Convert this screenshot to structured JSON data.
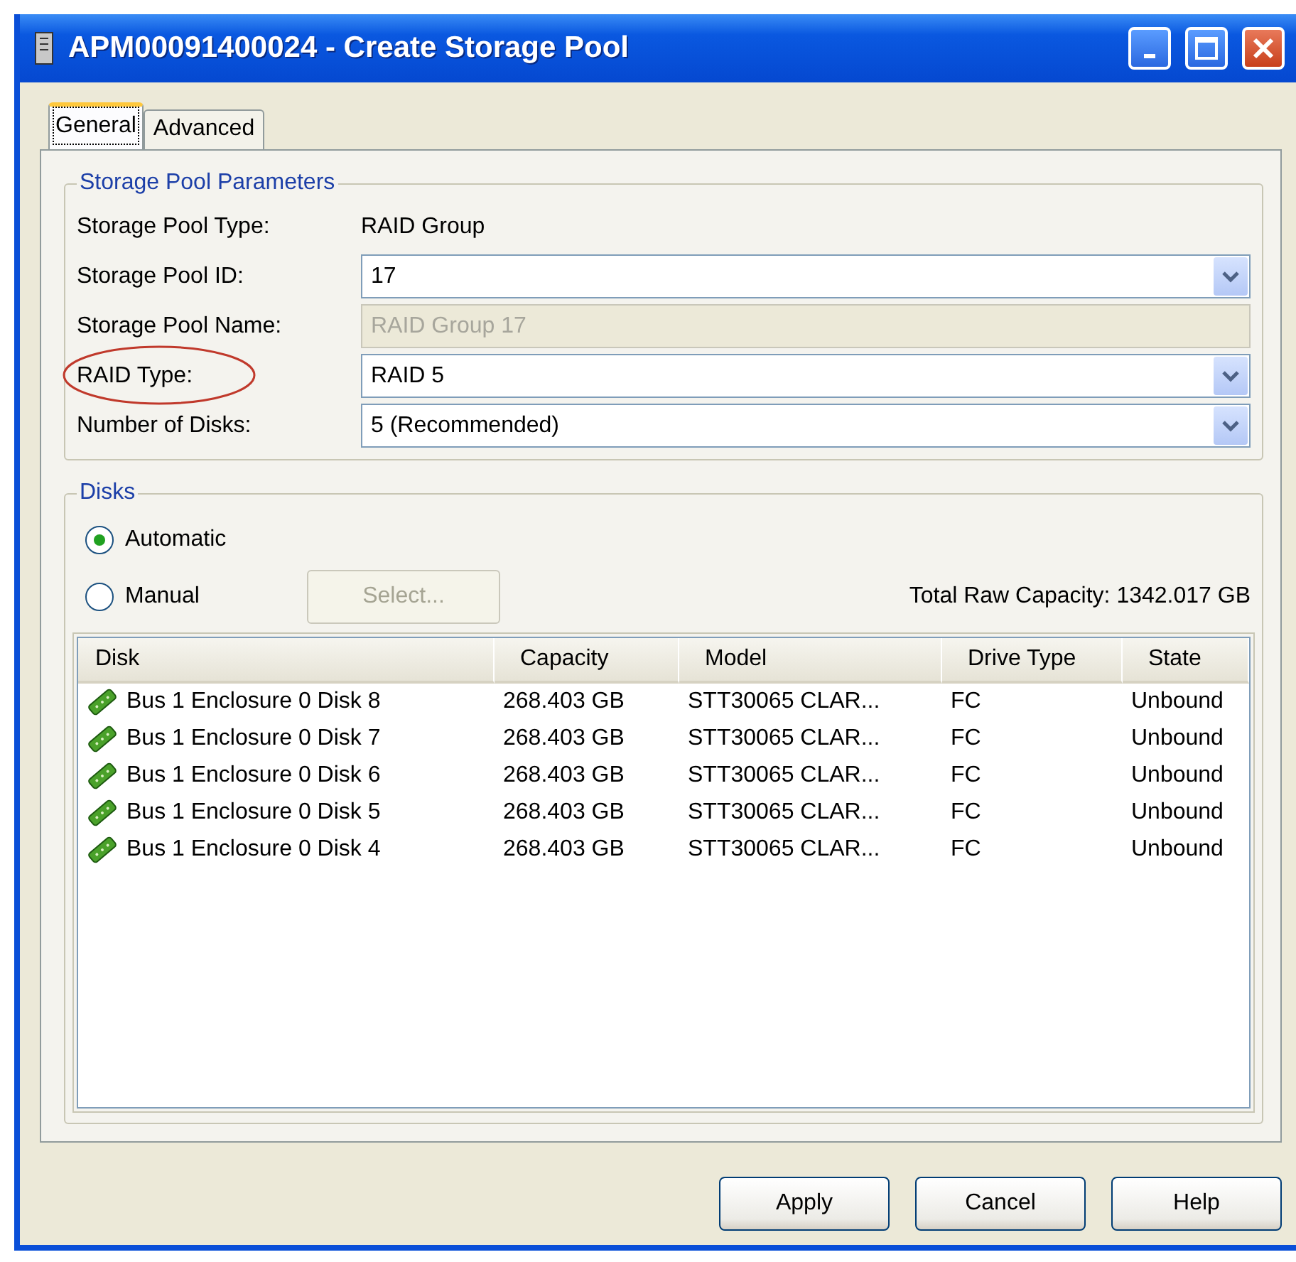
{
  "window": {
    "title": "APM00091400024 - Create Storage Pool"
  },
  "tabs": [
    {
      "label": "General",
      "selected": true
    },
    {
      "label": "Advanced",
      "selected": false
    }
  ],
  "parameters": {
    "title": "Storage Pool Parameters",
    "fields": [
      {
        "label": "Storage Pool Type:",
        "kind": "text",
        "value": "RAID Group",
        "circled": false
      },
      {
        "label": "Storage Pool ID:",
        "kind": "combo",
        "value": "17",
        "circled": false
      },
      {
        "label": "Storage Pool Name:",
        "kind": "readonly",
        "value": "RAID Group 17",
        "circled": false
      },
      {
        "label": "RAID Type:",
        "kind": "combo",
        "value": "RAID 5",
        "circled": true
      },
      {
        "label": "Number of Disks:",
        "kind": "combo",
        "value": "5 (Recommended)",
        "circled": false
      }
    ]
  },
  "disks": {
    "title": "Disks",
    "options": [
      {
        "label": "Automatic",
        "selected": true
      },
      {
        "label": "Manual",
        "selected": false
      }
    ],
    "select_button": {
      "label": "Select...",
      "disabled": true
    },
    "total": "Total Raw Capacity: 1342.017 GB",
    "table": {
      "columns": [
        "Disk",
        "Capacity",
        "Model",
        "Drive Type",
        "State"
      ],
      "rows": [
        [
          "Bus 1 Enclosure 0 Disk 8",
          "268.403 GB",
          "STT30065 CLAR...",
          "FC",
          "Unbound"
        ],
        [
          "Bus 1 Enclosure 0 Disk 7",
          "268.403 GB",
          "STT30065 CLAR...",
          "FC",
          "Unbound"
        ],
        [
          "Bus 1 Enclosure 0 Disk 6",
          "268.403 GB",
          "STT30065 CLAR...",
          "FC",
          "Unbound"
        ],
        [
          "Bus 1 Enclosure 0 Disk 5",
          "268.403 GB",
          "STT30065 CLAR...",
          "FC",
          "Unbound"
        ],
        [
          "Bus 1 Enclosure 0 Disk 4",
          "268.403 GB",
          "STT30065 CLAR...",
          "FC",
          "Unbound"
        ]
      ]
    }
  },
  "buttons": [
    "Apply",
    "Cancel",
    "Help"
  ]
}
